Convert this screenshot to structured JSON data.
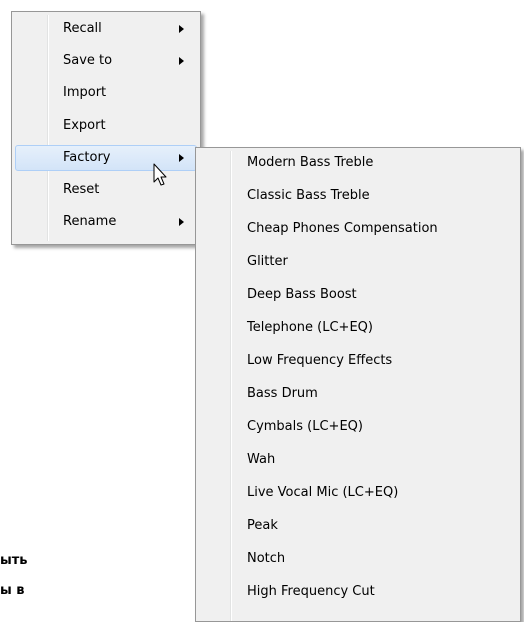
{
  "background": {
    "line1": "ыть",
    "line2": "ы в"
  },
  "menu": {
    "items": [
      {
        "label": "Recall",
        "has_submenu": true
      },
      {
        "label": "Save to",
        "has_submenu": true
      },
      {
        "label": "Import",
        "has_submenu": false
      },
      {
        "label": "Export",
        "has_submenu": false
      },
      {
        "label": "Factory",
        "has_submenu": true,
        "selected": true
      },
      {
        "label": "Reset",
        "has_submenu": false
      },
      {
        "label": "Rename",
        "has_submenu": true
      }
    ]
  },
  "submenu": {
    "items": [
      "Modern Bass Treble",
      "Classic Bass Treble",
      "Cheap Phones Compensation",
      "Glitter",
      "Deep Bass Boost",
      "Telephone (LC+EQ)",
      "Low Frequency Effects",
      "Bass Drum",
      "Cymbals (LC+EQ)",
      "Wah",
      "Live Vocal Mic (LC+EQ)",
      "Peak",
      "Notch",
      "High Frequency Cut"
    ]
  },
  "colors": {
    "menu_bg": "#f0f0f0",
    "menu_border": "#979797",
    "selected_bg": "#dce9f9",
    "selected_border": "#aecff7"
  },
  "icons": {
    "cursor": "arrow-cursor-icon",
    "submenu_arrow": "chevron-right-icon"
  }
}
